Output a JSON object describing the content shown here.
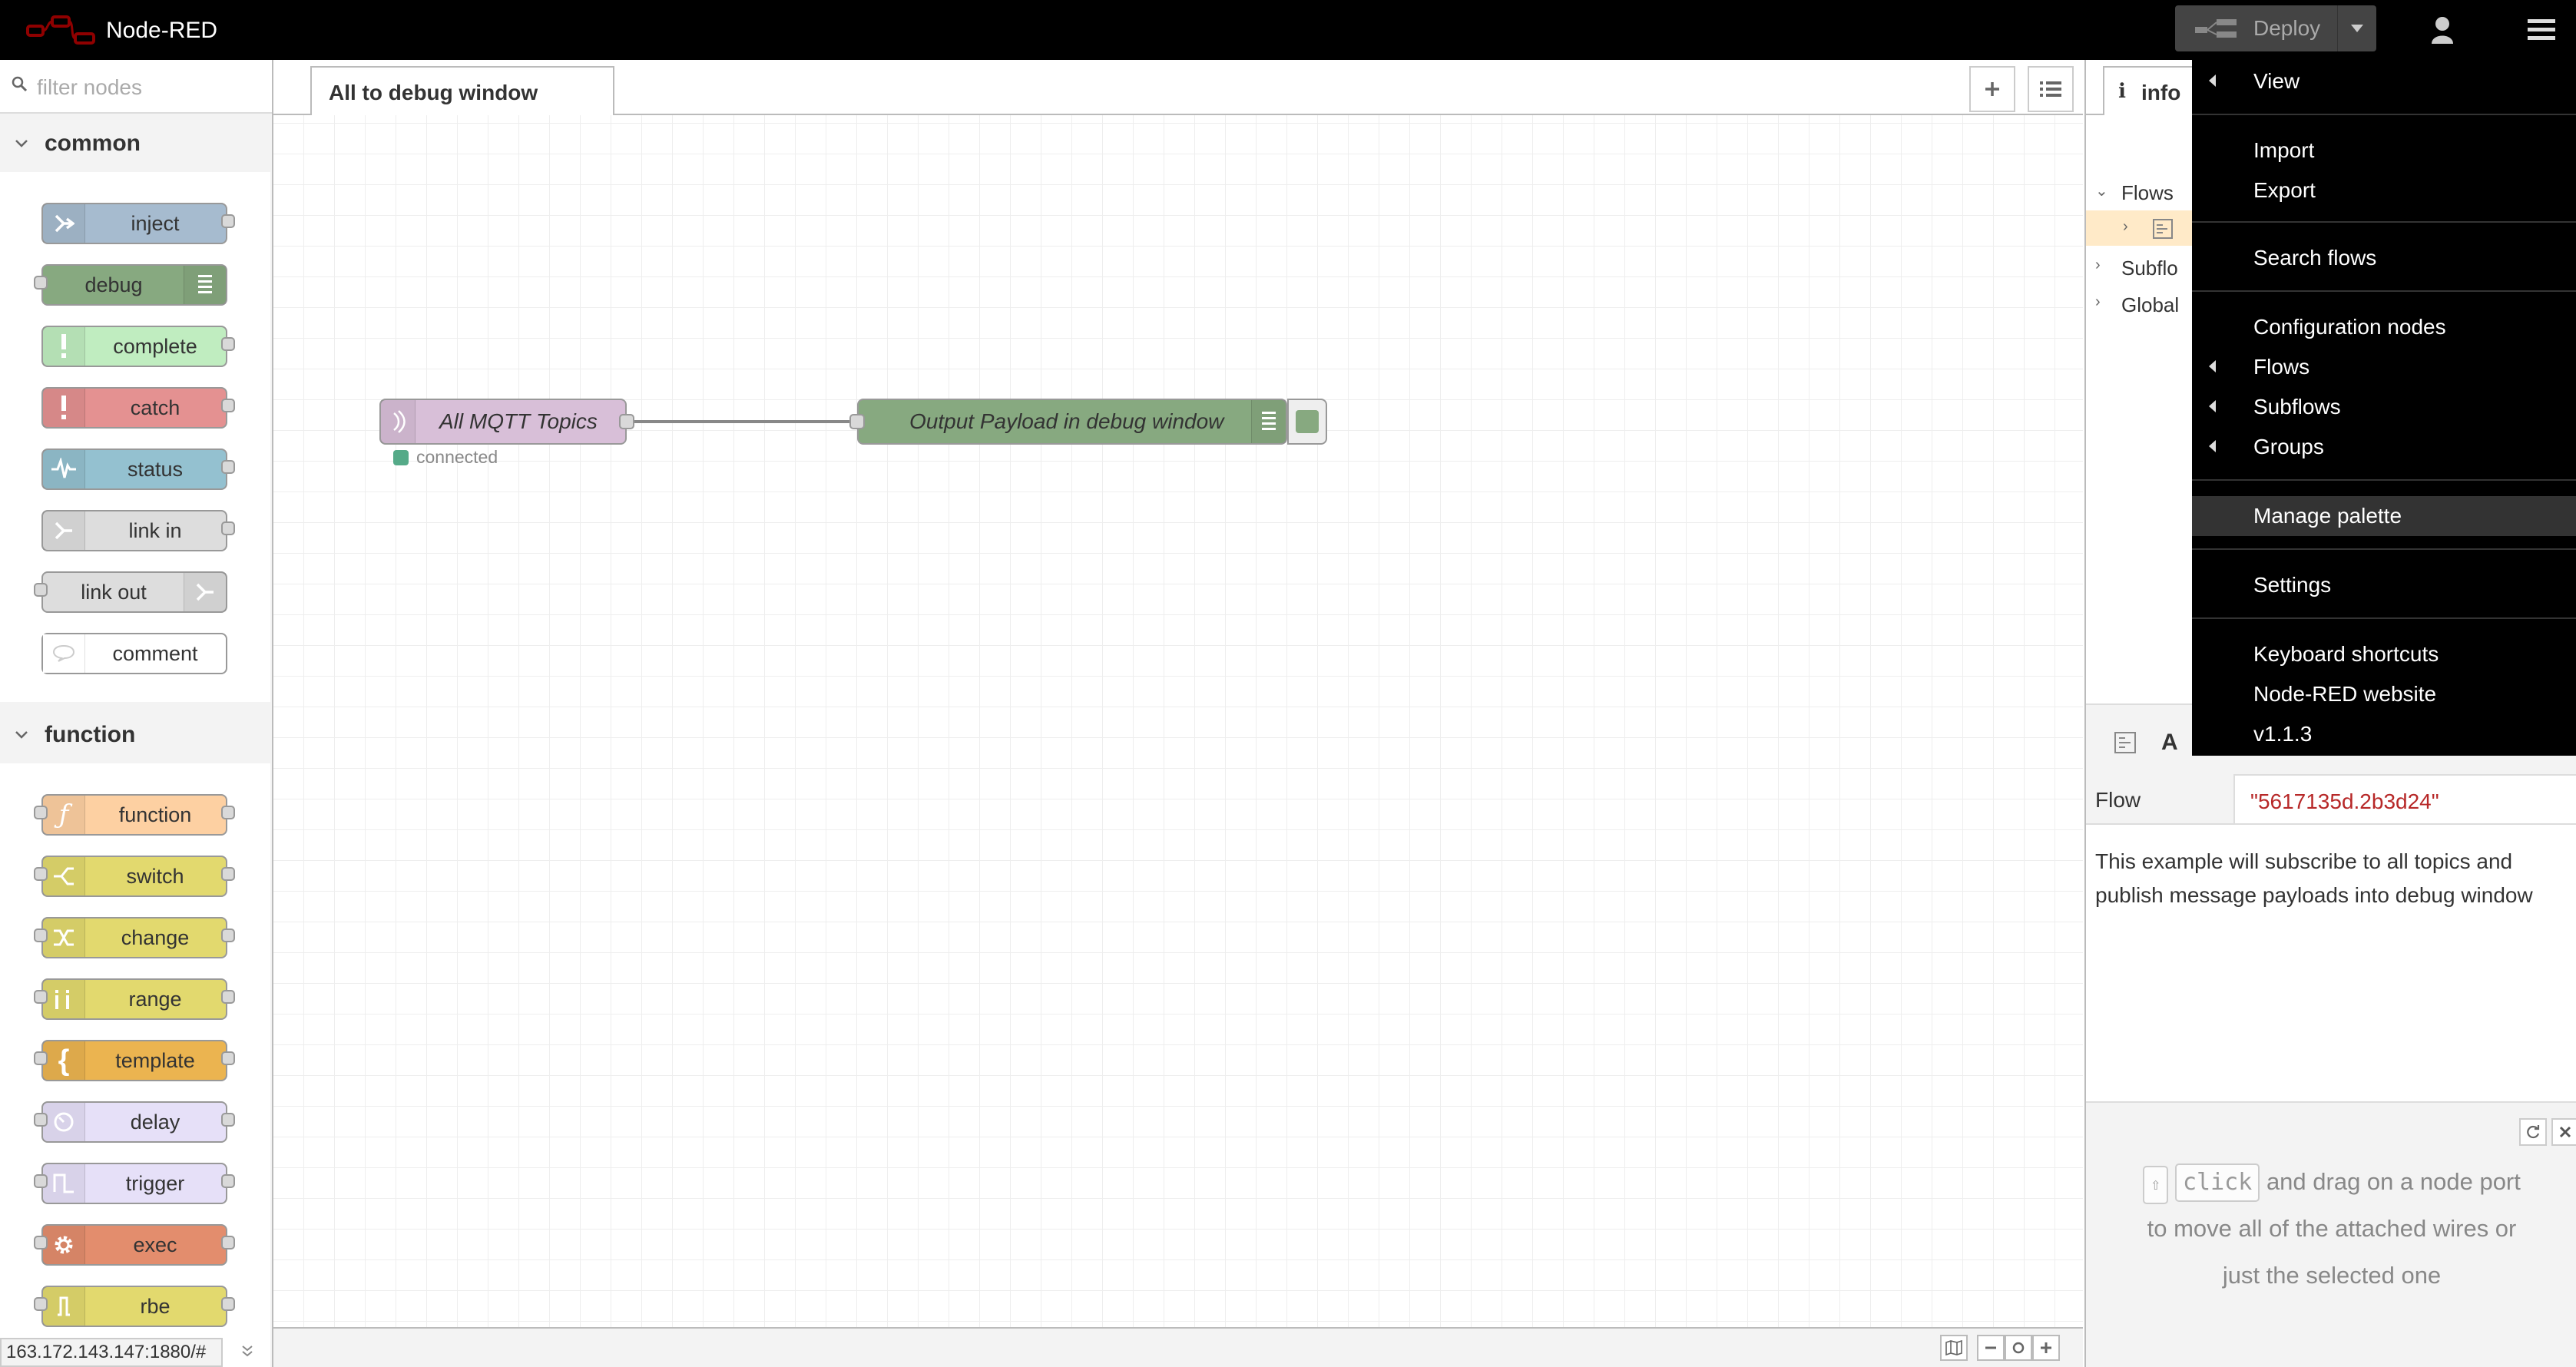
{
  "header": {
    "brand": "Node-RED",
    "deploy_label": "Deploy"
  },
  "palette": {
    "filter_placeholder": "filter nodes",
    "categories": [
      {
        "title": "common",
        "nodes": [
          {
            "label": "inject",
            "color": "#a6bbcf",
            "icon": "inject-arrow-icon"
          },
          {
            "label": "debug",
            "color": "#87a980",
            "icon": "debug-list-icon"
          },
          {
            "label": "complete",
            "color": "#c0edc0",
            "icon": "exclamation-icon"
          },
          {
            "label": "catch",
            "color": "#e49191",
            "icon": "exclamation-icon"
          },
          {
            "label": "status",
            "color": "#94c1d0",
            "icon": "pulse-icon"
          },
          {
            "label": "link in",
            "color": "#dddddd",
            "icon": "link-arrow-icon"
          },
          {
            "label": "link out",
            "color": "#dddddd",
            "icon": "link-arrow-icon"
          },
          {
            "label": "comment",
            "color": "#ffffff",
            "icon": "speech-bubble-icon"
          }
        ]
      },
      {
        "title": "function",
        "nodes": [
          {
            "label": "function",
            "color": "#fdd0a2",
            "icon": "function-f-icon"
          },
          {
            "label": "switch",
            "color": "#e2d96e",
            "icon": "switch-icon"
          },
          {
            "label": "change",
            "color": "#e2d96e",
            "icon": "shuffle-icon"
          },
          {
            "label": "range",
            "color": "#e2d96e",
            "icon": "range-icon"
          },
          {
            "label": "template",
            "color": "#ebb450",
            "icon": "brace-icon"
          },
          {
            "label": "delay",
            "color": "#e6e0f8",
            "icon": "timer-icon"
          },
          {
            "label": "trigger",
            "color": "#e6e0f8",
            "icon": "trigger-pulse-icon"
          },
          {
            "label": "exec",
            "color": "#e38d6d",
            "icon": "cog-icon"
          },
          {
            "label": "rbe",
            "color": "#e2d96e",
            "icon": "rbe-icon"
          }
        ]
      }
    ]
  },
  "workspace": {
    "tab_label": "All to debug window",
    "nodes": {
      "mqtt_label": "All MQTT Topics",
      "mqtt_status": "connected",
      "debug_label": "Output Payload in debug window"
    }
  },
  "sidebar": {
    "tab_label": "info",
    "tree": {
      "flows": "Flows",
      "subflows": "Subflo",
      "global": "Global"
    },
    "prop_header_text": "A",
    "properties": {
      "flow_key": "Flow",
      "flow_value": "\"5617135d.2b3d24\""
    },
    "description": "This example will subscribe to all topics and publish message payloads into debug window",
    "tip": {
      "key1": "⇧",
      "key2": "click",
      "text_a": "and drag on a node port",
      "text_b": "to move all of the attached wires or",
      "text_c": "just the selected one"
    }
  },
  "menu": {
    "items": [
      {
        "label": "View",
        "submenu": true
      },
      {
        "label": "Import",
        "submenu": false
      },
      {
        "label": "Export",
        "submenu": false
      },
      {
        "label": "Search flows",
        "submenu": false
      },
      {
        "label": "Configuration nodes",
        "submenu": false
      },
      {
        "label": "Flows",
        "submenu": true
      },
      {
        "label": "Subflows",
        "submenu": true
      },
      {
        "label": "Groups",
        "submenu": true
      },
      {
        "label": "Manage palette",
        "submenu": false,
        "highlighted": true
      },
      {
        "label": "Settings",
        "submenu": false
      },
      {
        "label": "Keyboard shortcuts",
        "submenu": false
      },
      {
        "label": "Node-RED website",
        "submenu": false
      },
      {
        "label": "v1.1.3",
        "submenu": false
      }
    ]
  },
  "status_bar": {
    "url": "163.172.143.147:1880/#"
  }
}
